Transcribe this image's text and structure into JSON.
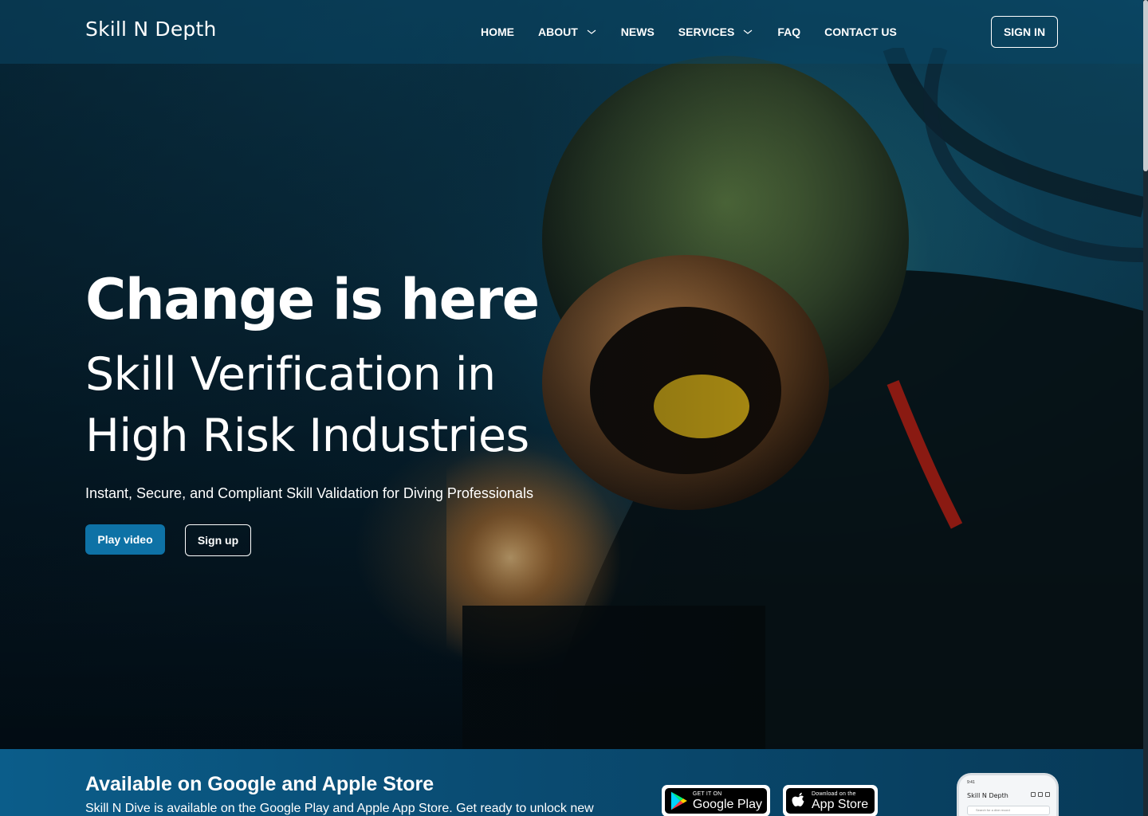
{
  "brand": {
    "name": "Skill N Depth"
  },
  "nav": {
    "items": [
      {
        "label": "HOME",
        "has_dropdown": false
      },
      {
        "label": "ABOUT",
        "has_dropdown": true
      },
      {
        "label": "NEWS",
        "has_dropdown": false
      },
      {
        "label": "SERVICES",
        "has_dropdown": true
      },
      {
        "label": "FAQ",
        "has_dropdown": false
      },
      {
        "label": "CONTACT US",
        "has_dropdown": false
      }
    ],
    "signin_label": "SIGN IN"
  },
  "hero": {
    "headline": "Change is here",
    "subtitle": "Skill Verification in High Risk Industries",
    "tagline": "Instant, Secure, and Compliant Skill Validation for Diving Professionals",
    "play_label": "Play video",
    "signup_label": "Sign up"
  },
  "banner": {
    "title": "Available on Google and Apple Store",
    "description": "Skill N Dive is available on the Google Play and Apple App Store. Get ready to unlock new",
    "google": {
      "small": "GET IT ON",
      "large": "Google Play"
    },
    "apple": {
      "small": "Download on the",
      "large": "App Store"
    },
    "phone": {
      "status_time": "9:41",
      "app_name": "Skill N Depth",
      "search_placeholder": "Search for a dive record"
    }
  },
  "colors": {
    "primary_button": "#0e72a6",
    "navbar": "#0a4664",
    "banner": "#0b5d8a"
  }
}
